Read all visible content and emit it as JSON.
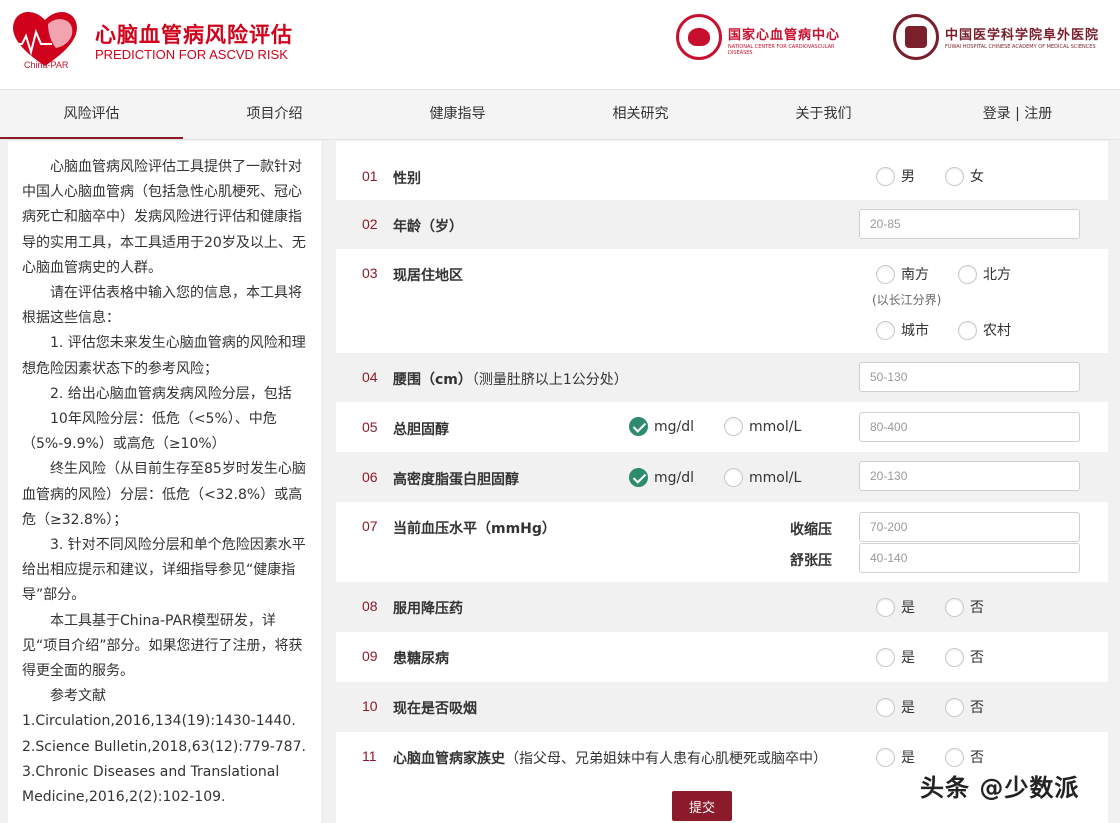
{
  "header": {
    "logo_text": "China-PAR",
    "title": "心脑血管病风险评估",
    "subtitle": "PREDICTION FOR ASCVD RISK",
    "partner1": {
      "name": "国家心血管病中心",
      "english": "NATIONAL CENTER FOR CARDIOVASCULAR DISEASES",
      "color": "#c8102e"
    },
    "partner2": {
      "name": "中国医学科学院阜外医院",
      "english": "FUWAI HOSPITAL  CHINESE ACADEMY OF MEDICAL SCIENCES",
      "color": "#7a1f2b"
    }
  },
  "nav": {
    "items": [
      {
        "label": "风险评估",
        "active": true
      },
      {
        "label": "项目介绍"
      },
      {
        "label": "健康指导"
      },
      {
        "label": "相关研究"
      },
      {
        "label": "关于我们"
      },
      {
        "label": "登录 | 注册"
      }
    ]
  },
  "sidebar": {
    "para1": "心脑血管病风险评估工具提供了一款针对中国人心脑血管病（包括急性心肌梗死、冠心病死亡和脑卒中）发病风险进行评估和健康指导的实用工具，本工具适用于20岁及以上、无心脑血管病史的人群。",
    "para2": "请在评估表格中输入您的信息，本工具将根据这些信息：",
    "para3": "1. 评估您未来发生心脑血管病的风险和理想危险因素状态下的参考风险；",
    "para4": "2. 给出心脑血管病发病风险分层，包括",
    "para5": "10年风险分层：低危（<5%）、中危（5%-9.9%）或高危（≥10%）",
    "para6": "终生风险（从目前生存至85岁时发生心脑血管病的风险）分层：低危（<32.8%）或高危（≥32.8%）；",
    "para7": "3. 针对不同风险分层和单个危险因素水平给出相应提示和建议，详细指导参见“健康指导”部分。",
    "para8": "本工具基于China-PAR模型研发，详见“项目介绍”部分。如果您进行了注册，将获得更全面的服务。",
    "ref_title": "参考文献",
    "ref1": "1.Circulation,2016,134(19):1430-1440.",
    "ref2": "2.Science Bulletin,2018,63(12):779-787.",
    "ref3": "3.Chronic Diseases and Translational Medicine,2016,2(2):102-109."
  },
  "form": {
    "q01": {
      "num": "01",
      "label": "性别",
      "opt1": "男",
      "opt2": "女"
    },
    "q02": {
      "num": "02",
      "label": "年龄（岁）",
      "placeholder": "20-85"
    },
    "q03": {
      "num": "03",
      "label": "现居住地区",
      "opt1": "南方",
      "opt2": "北方",
      "hint": "(以长江分界)",
      "opt3": "城市",
      "opt4": "农村"
    },
    "q04": {
      "num": "04",
      "label": "腰围（cm）",
      "note": "（测量肚脐以上1公分处）",
      "placeholder": "50-130"
    },
    "q05": {
      "num": "05",
      "label": "总胆固醇",
      "unit1": "mg/dl",
      "unit2": "mmol/L",
      "selected": "mg/dl",
      "placeholder": "80-400"
    },
    "q06": {
      "num": "06",
      "label": "高密度脂蛋白胆固醇",
      "unit1": "mg/dl",
      "unit2": "mmol/L",
      "selected": "mg/dl",
      "placeholder": "20-130"
    },
    "q07": {
      "num": "07",
      "label": "当前血压水平（mmHg）",
      "sys_label": "收缩压",
      "sys_placeholder": "70-200",
      "dia_label": "舒张压",
      "dia_placeholder": "40-140"
    },
    "q08": {
      "num": "08",
      "label": "服用降压药",
      "yes": "是",
      "no": "否"
    },
    "q09": {
      "num": "09",
      "label": "患糖尿病",
      "yes": "是",
      "no": "否"
    },
    "q10": {
      "num": "10",
      "label": "现在是否吸烟",
      "yes": "是",
      "no": "否"
    },
    "q11": {
      "num": "11",
      "label": "心脑血管病家族史",
      "note": "（指父母、兄弟姐妹中有人患有心肌梗死或脑卒中）",
      "yes": "是",
      "no": "否"
    },
    "submit_label": "提交"
  },
  "watermark": "头条 @少数派",
  "colors": {
    "brand_red": "#d0021b",
    "accent_maroon": "#8b1a2b",
    "check_green": "#2e8b6b"
  }
}
